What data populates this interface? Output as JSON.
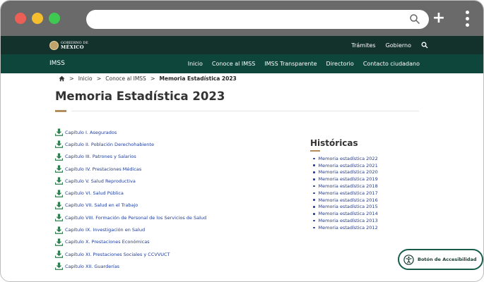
{
  "browser": {
    "icons": [
      "close-dot",
      "minimize-dot",
      "maximize-dot",
      "search-icon",
      "plus-icon",
      "kebab-menu-icon"
    ],
    "new_tab_label": "+"
  },
  "gov_header": {
    "logo_top": "GOBIERNO DE",
    "logo_main": "MÉXICO",
    "links": [
      "Trámites",
      "Gobierno"
    ],
    "bg_color": "#13322b"
  },
  "imss_header": {
    "brand": "IMSS",
    "nav": [
      "Inicio",
      "Conoce al IMSS",
      "IMSS Transparente",
      "Directorio",
      "Contacto ciudadano"
    ],
    "bg_color": "#0f463c"
  },
  "breadcrumb": {
    "items": [
      "Inicio",
      "Conoce al IMSS"
    ],
    "current": "Memoria Estadística 2023",
    "separator": ">"
  },
  "page": {
    "title": "Memoria Estadística 2023",
    "accent_color": "#b38e5d",
    "link_color": "#1f3c9b"
  },
  "chapters": [
    "Capítulo I. Asegurados",
    "Capítulo II. Población Derechohabiente",
    "Capítulo III. Patrones y Salarios",
    "Capítulo IV. Prestaciones Médicas",
    "Capítulo V. Salud Reproductiva",
    "Capítulo VI. Salud Pública",
    "Capítulo VII. Salud en el Trabajo",
    "Capítulo VIII. Formación de Personal de los Servicios de Salud",
    "Capítulo IX. Investigación en Salud",
    "Capítulo X. Prestaciones Económicas",
    "Capítulo XI. Prestaciones Sociales y CCVVUCT",
    "Capítulo XII. Guarderías"
  ],
  "historicas": {
    "title": "Históricas",
    "items": [
      "Memoria estadística 2022",
      "Memoria estadística 2021",
      "Memoria estadística 2020",
      "Memoria estadística 2019",
      "Memoria estadística 2018",
      "Memoria estadística 2017",
      "Memoria estadística 2016",
      "Memoria estadística 2015",
      "Memoria estadística 2014",
      "Memoria estadística 2013",
      "Memoria estadística 2012"
    ]
  },
  "accessibility": {
    "label": "Botón de Accesibilidad",
    "icon": "accessibility-icon"
  }
}
